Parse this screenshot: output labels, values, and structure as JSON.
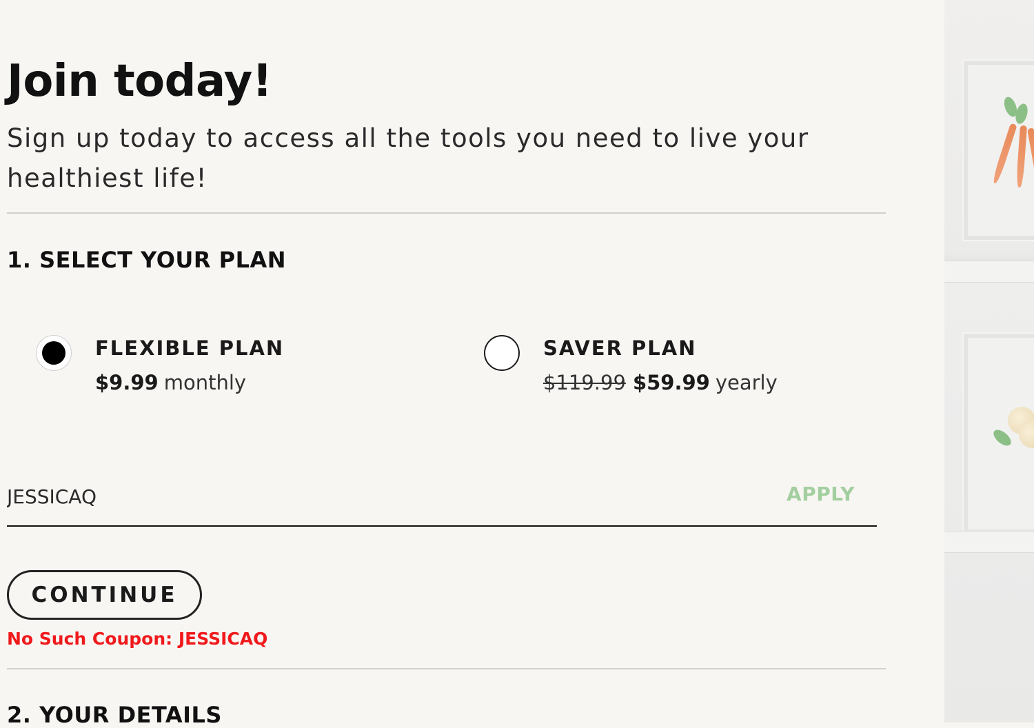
{
  "header": {
    "title": "Join today!",
    "subtitle": "Sign up today to access all the tools you need to live your healthiest life!"
  },
  "plan_section": {
    "heading": "1. SELECT YOUR PLAN",
    "plans": [
      {
        "name": "FLEXIBLE PLAN",
        "price": "$9.99",
        "period": "monthly",
        "selected": true
      },
      {
        "name": "SAVER PLAN",
        "old_price": "$119.99",
        "price": "$59.99",
        "period": "yearly",
        "selected": false
      }
    ]
  },
  "coupon": {
    "value": "JESSICAQ",
    "apply_label": "APPLY"
  },
  "continue_label": "CONTINUE",
  "error_message": "No Such Coupon: JESSICAQ",
  "details_section": {
    "heading": "2. YOUR DETAILS"
  },
  "colors": {
    "background": "#f8f6f3",
    "error": "#f0191c",
    "apply": "#a3cfa0",
    "text": "#111111"
  }
}
